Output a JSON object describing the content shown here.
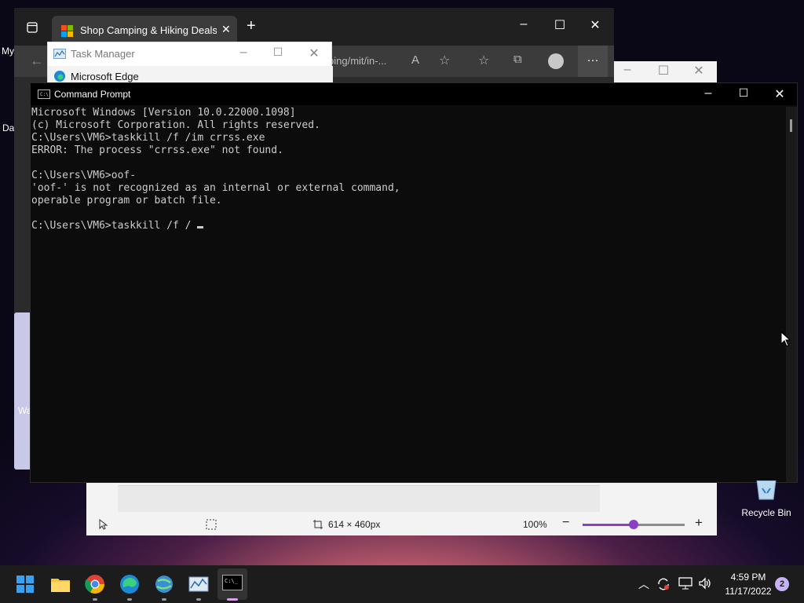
{
  "desktop": {
    "left_edge_texts": [
      "My",
      "Da",
      "Wa"
    ],
    "recycle_bin_label": "Recycle Bin"
  },
  "edge": {
    "tab_title": "Shop Camping & Hiking Deals, C",
    "address_fragment": "ping/mit/in-...",
    "brand_colors": [
      "#f25022",
      "#7fba00",
      "#00a4ef",
      "#ffb900"
    ]
  },
  "task_manager": {
    "title": "Task Manager",
    "process_row": "Microsoft Edge"
  },
  "paint": {
    "canvas_size": "614 × 460px",
    "zoom": "100%",
    "zoom_fraction": 0.5,
    "accent": "#8a3fc4"
  },
  "cmd": {
    "title": "Command Prompt",
    "lines": [
      "Microsoft Windows [Version 10.0.22000.1098]",
      "(c) Microsoft Corporation. All rights reserved.",
      "C:\\Users\\VM6>taskkill /f /im crrss.exe",
      "ERROR: The process \"crrss.exe\" not found.",
      "",
      "C:\\Users\\VM6>oof-",
      "'oof-' is not recognized as an internal or external command,",
      "operable program or batch file.",
      "",
      "C:\\Users\\VM6>taskkill /f / "
    ],
    "text_color": "#cccccc",
    "background": "#0c0c0c"
  },
  "taskbar": {
    "apps": [
      "start",
      "file-explorer",
      "chrome",
      "edge",
      "network-tool",
      "task-manager",
      "command-prompt"
    ],
    "time": "4:59 PM",
    "date": "11/17/2022",
    "notification_count": "2"
  }
}
